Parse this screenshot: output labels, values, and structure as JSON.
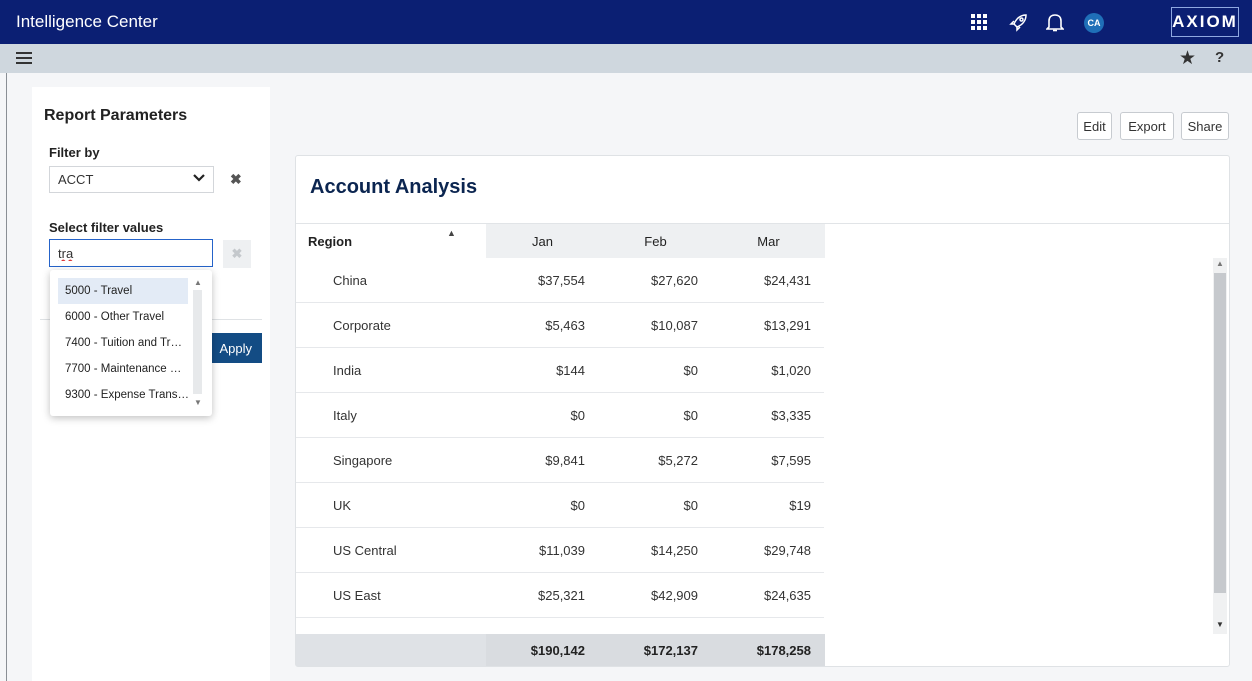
{
  "app": {
    "title": "Intelligence Center",
    "logo": "AXIOM",
    "avatar_initials": "CA",
    "icons": [
      "apps-grid-icon",
      "rocket-icon",
      "bell-icon",
      "star-icon",
      "help-icon",
      "menu-icon"
    ],
    "help_label": "?"
  },
  "params": {
    "title": "Report Parameters",
    "filter_by_label": "Filter by",
    "filter_by_value": "ACCT",
    "select_values_label": "Select filter values",
    "search_value": "tra",
    "apply_label": "Apply",
    "options": [
      "5000 - Travel",
      "6000 - Other Travel",
      "7400 - Tuition and Tr…",
      "7700 - Maintenance …",
      "9300 - Expense Trans…"
    ],
    "selected_option": "5000 - Travel"
  },
  "actions": {
    "edit": "Edit",
    "export": "Export",
    "share": "Share"
  },
  "report": {
    "title": "Account Analysis",
    "columns": [
      "Region",
      "Jan",
      "Feb",
      "Mar"
    ],
    "rows": [
      {
        "region": "China",
        "jan": "$37,554",
        "feb": "$27,620",
        "mar": "$24,431"
      },
      {
        "region": "Corporate",
        "jan": "$5,463",
        "feb": "$10,087",
        "mar": "$13,291"
      },
      {
        "region": "India",
        "jan": "$144",
        "feb": "$0",
        "mar": "$1,020"
      },
      {
        "region": "Italy",
        "jan": "$0",
        "feb": "$0",
        "mar": "$3,335"
      },
      {
        "region": "Singapore",
        "jan": "$9,841",
        "feb": "$5,272",
        "mar": "$7,595"
      },
      {
        "region": "UK",
        "jan": "$0",
        "feb": "$0",
        "mar": "$19"
      },
      {
        "region": "US Central",
        "jan": "$11,039",
        "feb": "$14,250",
        "mar": "$29,748"
      },
      {
        "region": "US East",
        "jan": "$25,321",
        "feb": "$42,909",
        "mar": "$24,635"
      }
    ],
    "totals": {
      "jan": "$190,142",
      "feb": "$172,137",
      "mar": "$178,258"
    }
  },
  "colors": {
    "topbar": "#0b1f73",
    "subbar": "#cfd7de",
    "apply": "#134c84",
    "title": "#0b2550"
  }
}
